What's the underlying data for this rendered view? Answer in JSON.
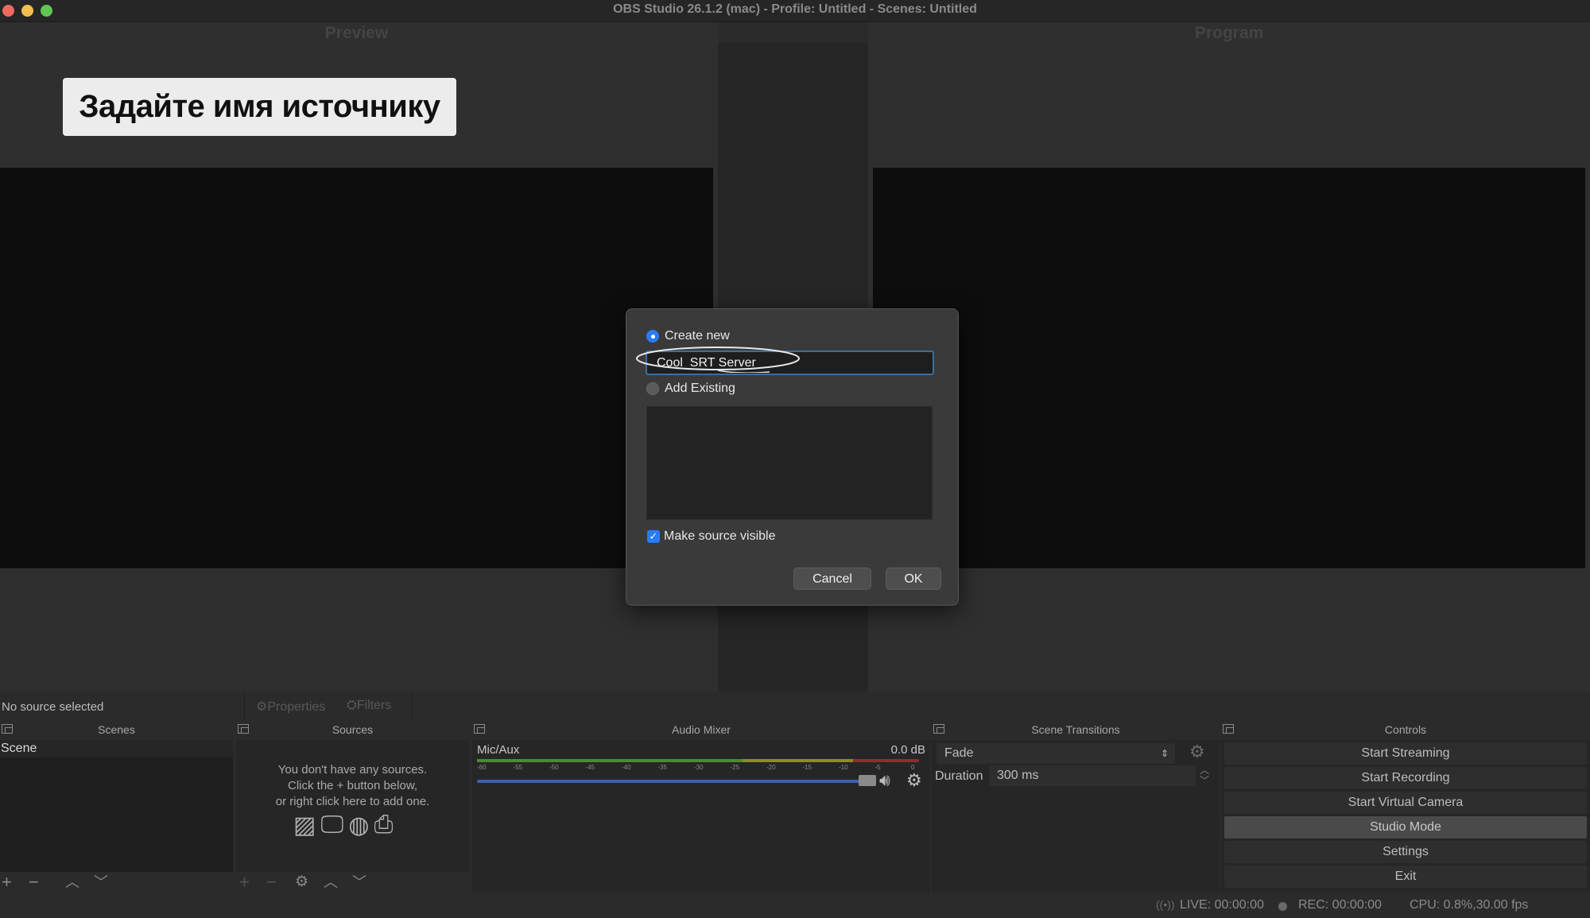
{
  "window": {
    "title": "OBS Studio 26.1.2 (mac) - Profile: Untitled - Scenes: Untitled",
    "traffic_colors": [
      "#ed6a5e",
      "#f5bf4f",
      "#61c554"
    ]
  },
  "panes": {
    "preview_label": "Preview",
    "program_label": "Program"
  },
  "annotation": {
    "text": "Задайте имя источнику"
  },
  "dialog": {
    "create_new_label": "Create new",
    "create_new_selected": true,
    "name_value": "Cool  SRT Server",
    "add_existing_label": "Add Existing",
    "add_existing_selected": false,
    "make_visible_label": "Make source visible",
    "make_visible_checked": true,
    "cancel_label": "Cancel",
    "ok_label": "OK"
  },
  "source_toolbar": {
    "status": "No source selected",
    "properties_label": "Properties",
    "filters_label": "Filters"
  },
  "docks": {
    "scenes": {
      "title": "Scenes",
      "items": [
        "Scene"
      ]
    },
    "sources": {
      "title": "Sources",
      "empty_line1": "You don't have any sources.",
      "empty_line2": "Click the + button below,",
      "empty_line3": "or right click here to add one."
    },
    "audio_mixer": {
      "title": "Audio Mixer",
      "channel_name": "Mic/Aux",
      "level": "0.0 dB",
      "ticks": [
        "-60",
        "-55",
        "-50",
        "-45",
        "-40",
        "-35",
        "-30",
        "-25",
        "-20",
        "-15",
        "-10",
        "-5",
        "0"
      ]
    },
    "scene_transitions": {
      "title": "Scene Transitions",
      "transition": "Fade",
      "duration_label": "Duration",
      "duration_value": "300 ms"
    },
    "controls": {
      "title": "Controls",
      "buttons": [
        "Start Streaming",
        "Start Recording",
        "Start Virtual Camera",
        "Studio Mode",
        "Settings",
        "Exit"
      ]
    }
  },
  "status": {
    "live": "LIVE: 00:00:00",
    "rec": "REC: 00:00:00",
    "cpu": "CPU: 0.8%,30.00 fps"
  },
  "colors": {
    "accent": "#2a7bf6",
    "meter_green": "#4c8a2f",
    "meter_yellow": "#8a8a2f",
    "meter_red": "#8a2f2f",
    "volume_track": "#3a5fb0"
  }
}
